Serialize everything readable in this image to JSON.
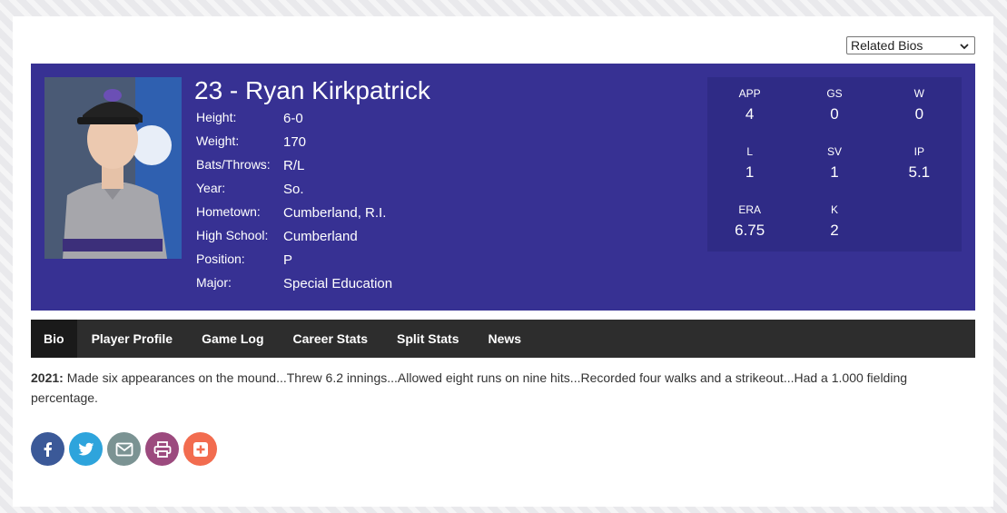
{
  "related_bios": {
    "selected": "Related Bios"
  },
  "player": {
    "title": "23 - Ryan Kirkpatrick",
    "facts": [
      {
        "label": "Height:",
        "value": "6-0"
      },
      {
        "label": "Weight:",
        "value": "170"
      },
      {
        "label": "Bats/Throws:",
        "value": "R/L"
      },
      {
        "label": "Year:",
        "value": "So."
      },
      {
        "label": "Hometown:",
        "value": "Cumberland, R.I."
      },
      {
        "label": "High School:",
        "value": "Cumberland"
      },
      {
        "label": "Position:",
        "value": "P"
      },
      {
        "label": "Major:",
        "value": "Special Education"
      }
    ]
  },
  "stats": [
    {
      "label": "APP",
      "value": "4"
    },
    {
      "label": "GS",
      "value": "0"
    },
    {
      "label": "W",
      "value": "0"
    },
    {
      "label": "L",
      "value": "1"
    },
    {
      "label": "SV",
      "value": "1"
    },
    {
      "label": "IP",
      "value": "5.1"
    },
    {
      "label": "ERA",
      "value": "6.75"
    },
    {
      "label": "K",
      "value": "2"
    }
  ],
  "tabs": [
    "Bio",
    "Player Profile",
    "Game Log",
    "Career Stats",
    "Split Stats",
    "News"
  ],
  "bio": {
    "year": "2021:",
    "text": " Made six appearances on the mound...Threw 6.2 innings...Allowed eight runs on nine hits...Recorded four walks and a strikeout...Had a 1.000 fielding percentage."
  },
  "share": [
    {
      "icon": "facebook-icon",
      "color": "#3b5998"
    },
    {
      "icon": "twitter-icon",
      "color": "#2ea4dc"
    },
    {
      "icon": "email-icon",
      "color": "#7b9393"
    },
    {
      "icon": "print-icon",
      "color": "#9c4a7e"
    },
    {
      "icon": "add-icon",
      "color": "#f26c4f"
    }
  ],
  "colors": {
    "banner": "#373193",
    "stats_box": "#2f2b86",
    "tabs_bar": "#2d2d2d"
  }
}
